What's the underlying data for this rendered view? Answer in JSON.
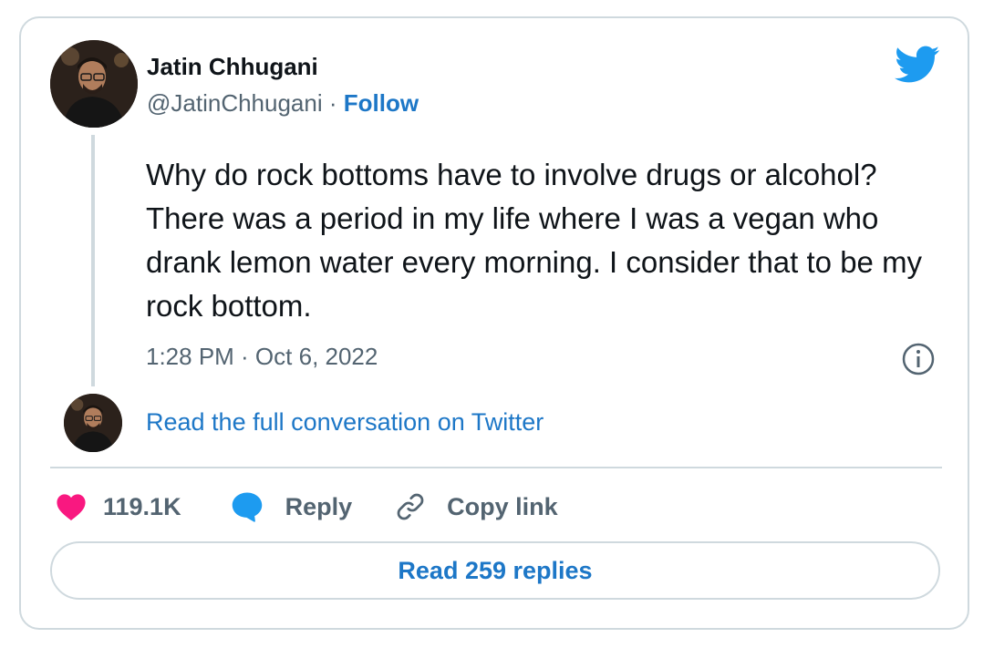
{
  "author": {
    "name": "Jatin Chhugani",
    "handle": "@JatinChhugani",
    "separator": "·",
    "follow_label": "Follow"
  },
  "tweet": {
    "text": "Why do rock bottoms have to involve drugs or alcohol? There was a period in my life where I was a vegan who drank lemon water every morning. I consider that to be my rock bottom.",
    "timestamp": "1:28 PM · Oct 6, 2022"
  },
  "conversation": {
    "read_full_label": "Read the full conversation on Twitter"
  },
  "actions": {
    "like_count": "119.1K",
    "reply_label": "Reply",
    "copy_link_label": "Copy link"
  },
  "replies": {
    "button_label": "Read 259 replies"
  },
  "icons": {
    "brand": "twitter-bird-icon",
    "info": "info-icon",
    "like": "heart-icon",
    "reply": "speech-bubble-icon",
    "copy": "link-icon"
  },
  "colors": {
    "accent": "#1d77c7",
    "brand": "#1d9bf0",
    "like": "#f91880",
    "muted": "#536471",
    "border": "#cfd9de"
  }
}
